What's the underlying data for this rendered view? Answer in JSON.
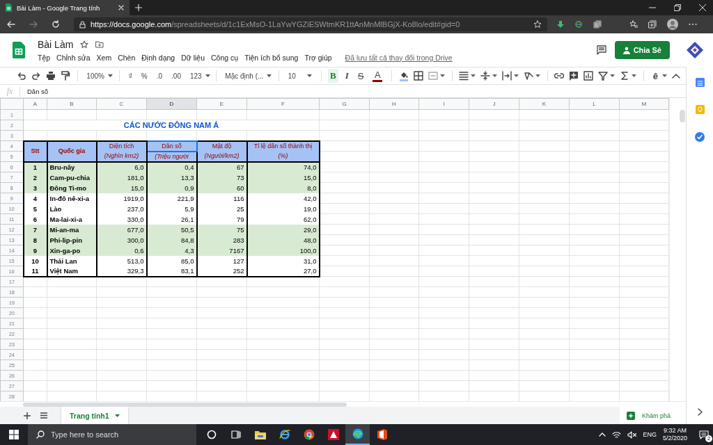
{
  "browser": {
    "tab_title": "Bài Làm - Google Trang tính",
    "url_host": "https://docs.google.com",
    "url_path": "/spreadsheets/d/1c1ExMsO-1LaYwYGZiESWtmKR1ttAnMnMlBGjX-Ko8lo/edit#gid=0"
  },
  "doc": {
    "title": "Bài Làm",
    "menus": [
      "Tệp",
      "Chỉnh sửa",
      "Xem",
      "Chèn",
      "Định dạng",
      "Dữ liệu",
      "Công cụ",
      "Tiện ích bổ sung",
      "Trợ giúp"
    ],
    "save_status": "Đã lưu tất cả thay đổi trong Drive",
    "share_button": "Chia Sẻ"
  },
  "toolbar": {
    "zoom": "100%",
    "currency": "₫",
    "percent": "%",
    "decrease_decimals": ".0",
    "increase_decimals": ".00",
    "number_format": "123",
    "font": "Mặc định (...",
    "font_size": "10",
    "bold": {
      "label": "B",
      "selected": true
    },
    "italic": {
      "label": "I",
      "selected": false
    },
    "strikethrough": {
      "label": "S",
      "selected": false
    },
    "text_color": {
      "label": "A"
    },
    "input_tools": "ê"
  },
  "formula_bar": {
    "label": "fx",
    "value": "Dân số"
  },
  "grid": {
    "columns": [
      {
        "label": "A",
        "selected": false
      },
      {
        "label": "B",
        "selected": false
      },
      {
        "label": "C",
        "selected": false
      },
      {
        "label": "D",
        "selected": true
      },
      {
        "label": "E",
        "selected": false
      },
      {
        "label": "F",
        "selected": false
      },
      {
        "label": "G",
        "selected": false
      },
      {
        "label": "H",
        "selected": false
      },
      {
        "label": "I",
        "selected": false
      },
      {
        "label": "J",
        "selected": false
      },
      {
        "label": "K",
        "selected": false
      },
      {
        "label": "L",
        "selected": false
      },
      {
        "label": "M",
        "selected": false
      }
    ],
    "row_numbers": [
      "1",
      "2",
      "3",
      "4",
      "5",
      "6",
      "7",
      "8",
      "9",
      "10",
      "11",
      "12",
      "13",
      "14",
      "15",
      "16",
      "17",
      "18",
      "19",
      "20",
      "21",
      "22",
      "23",
      "24",
      "25",
      "26",
      "27",
      "28"
    ]
  },
  "table": {
    "title": "CÁC NƯỚC ĐÔNG NAM Á",
    "headers": [
      {
        "top": "Stt",
        "selected": false
      },
      {
        "top": "Quốc gia",
        "selected": false
      },
      {
        "top": "Diện tích",
        "bottom": "(Nghìn km2)",
        "selected": false
      },
      {
        "top": "Dân số",
        "bottom": "(Triệu người",
        "selected": true
      },
      {
        "top": "Mật độ",
        "bottom": "(Người/km2)",
        "selected": false
      },
      {
        "top": "Tỉ lệ dân số thành thị",
        "bottom": "(%)",
        "selected": false
      }
    ],
    "rows": [
      {
        "cells": [
          "1",
          "Bru-nây",
          "6,0",
          "0,4",
          "67",
          "74,0"
        ],
        "highlighted": true
      },
      {
        "cells": [
          "2",
          "Cam-pu-chia",
          "181,0",
          "13,3",
          "73",
          "15,0"
        ],
        "highlighted": true
      },
      {
        "cells": [
          "3",
          "Đông Ti-mo",
          "15,0",
          "0,9",
          "60",
          "8,0"
        ],
        "highlighted": true
      },
      {
        "cells": [
          "4",
          "In-đô nê-xi-a",
          "1919,0",
          "221,9",
          "116",
          "42,0"
        ],
        "highlighted": false
      },
      {
        "cells": [
          "5",
          "Lào",
          "237,0",
          "5,9",
          "25",
          "19,0"
        ],
        "highlighted": false
      },
      {
        "cells": [
          "6",
          "Ma-lai-xi-a",
          "330,0",
          "26,1",
          "79",
          "62,0"
        ],
        "highlighted": false
      },
      {
        "cells": [
          "7",
          "Mi-an-ma",
          "677,0",
          "50,5",
          "75",
          "29,0"
        ],
        "highlighted": true
      },
      {
        "cells": [
          "8",
          "Phi-lip-pin",
          "300,0",
          "84,8",
          "283",
          "48,0"
        ],
        "highlighted": true
      },
      {
        "cells": [
          "9",
          "Xin-ga-po",
          "0,6",
          "4,3",
          "7167",
          "100,0"
        ],
        "highlighted": true
      },
      {
        "cells": [
          "10",
          "Thái Lan",
          "513,0",
          "85,0",
          "127",
          "31,0"
        ],
        "highlighted": false
      },
      {
        "cells": [
          "11",
          "Việt Nam",
          "329,3",
          "83,1",
          "252",
          "27,0"
        ],
        "highlighted": false
      }
    ]
  },
  "sheet_tabs": [
    {
      "label": "Trang tính1",
      "selected": true
    }
  ],
  "explore_button": "Khám phá",
  "taskbar": {
    "search_placeholder": "Type here to search",
    "language": "ENG",
    "time": "9:32 AM",
    "date": "5/2/2020",
    "notification_count": "2"
  }
}
